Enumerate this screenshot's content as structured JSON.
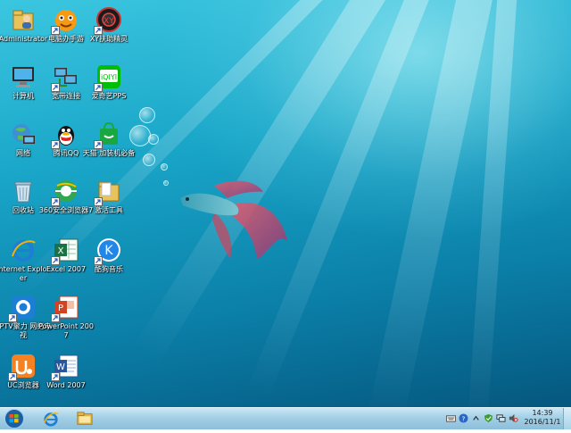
{
  "desktop": {
    "icons": [
      {
        "label": "Administrator",
        "icon": "user-folder-icon",
        "shortcut": false
      },
      {
        "label": "电脑办手游",
        "icon": "game-assistant-icon",
        "shortcut": true
      },
      {
        "label": "XY扶助精灵",
        "icon": "xy-assistant-icon",
        "shortcut": true
      },
      {
        "label": "计算机",
        "icon": "computer-icon",
        "shortcut": false
      },
      {
        "label": "宽带连接",
        "icon": "network-connection-icon",
        "shortcut": true
      },
      {
        "label": "爱奇艺PPS",
        "icon": "iqiyi-icon",
        "shortcut": true
      },
      {
        "label": "网络",
        "icon": "network-globe-icon",
        "shortcut": false
      },
      {
        "label": "腾讯QQ",
        "icon": "qq-icon",
        "shortcut": true
      },
      {
        "label": "天猫·加装机必备",
        "icon": "tmall-bag-icon",
        "shortcut": true
      },
      {
        "label": "回收站",
        "icon": "recycle-bin-icon",
        "shortcut": false
      },
      {
        "label": "360安全浏览器7",
        "icon": "browser-360-icon",
        "shortcut": true
      },
      {
        "label": "激活工具",
        "icon": "folder-icon",
        "shortcut": true
      },
      {
        "label": "Internet Explorer",
        "icon": "internet-explorer-icon",
        "shortcut": false
      },
      {
        "label": "Excel 2007",
        "icon": "excel-icon",
        "shortcut": true
      },
      {
        "label": "酷狗音乐",
        "icon": "kugou-icon",
        "shortcut": true
      },
      {
        "label": "PPTV聚力 网络电视",
        "icon": "pptv-icon",
        "shortcut": true
      },
      {
        "label": "PowerPoint 2007",
        "icon": "powerpoint-icon",
        "shortcut": true
      },
      {
        "label": "UC浏览器",
        "icon": "uc-browser-icon",
        "shortcut": true
      },
      {
        "label": "Word 2007",
        "icon": "word-icon",
        "shortcut": true
      }
    ]
  },
  "taskbar": {
    "pinned": [
      {
        "icon": "internet-explorer-icon"
      },
      {
        "icon": "file-explorer-icon"
      }
    ],
    "tray_icons": [
      "keyboard-icon",
      "help-icon",
      "expand-icon",
      "security-icon",
      "network-icon",
      "volume-muted-icon"
    ],
    "clock": {
      "time": "14:39",
      "date": "2016/11/1"
    }
  },
  "colors": {
    "desktop_accent": "#19a6c8",
    "taskbar": "#a3cfe6"
  }
}
